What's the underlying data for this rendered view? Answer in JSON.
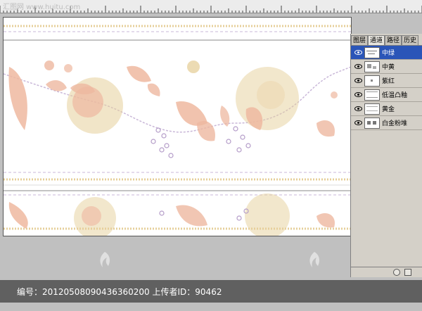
{
  "watermark_top": "汇图网 www.huitu.com",
  "palette": {
    "tabs": [
      "图层",
      "通道",
      "路径",
      "历史"
    ],
    "active_tab": "通道",
    "channels": [
      {
        "name": "中绿",
        "selected": true
      },
      {
        "name": "中黄",
        "selected": false
      },
      {
        "name": "紫红",
        "selected": false
      },
      {
        "name": "低温凸釉",
        "selected": false
      },
      {
        "name": "黄金",
        "selected": false
      },
      {
        "name": "白金粉堆",
        "selected": false
      }
    ]
  },
  "footer": {
    "text": "编号：20120508090436360200 上传者ID：90462"
  },
  "colors": {
    "selected_row": "#2a55b8",
    "peach": "#eeb8a0",
    "gold": "#e6cf9a",
    "purple": "#b49cc8",
    "dashed_line": "#c9b7d8"
  },
  "icons": {
    "eye": "eye-icon",
    "watermark": "huitu-logo"
  }
}
